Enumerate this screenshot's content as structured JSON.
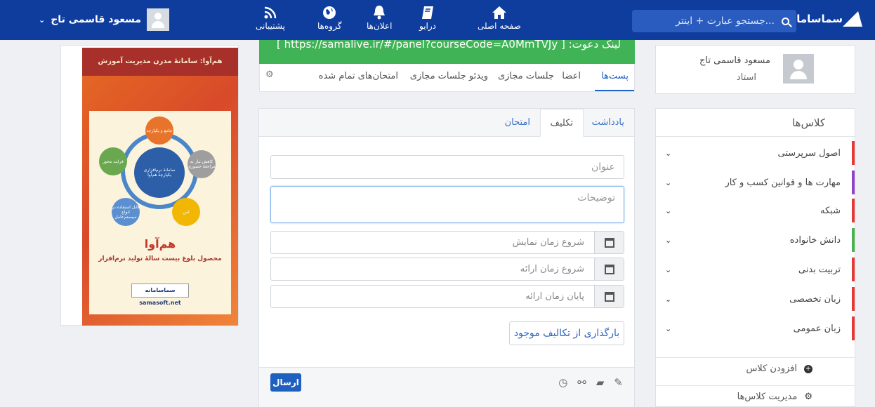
{
  "topbar": {
    "brand": "سماسامانه",
    "search_placeholder": "جستجو عبارت + اینتر...",
    "nav": {
      "home": "صفحه اصلی",
      "drive": "درایو",
      "notifications": "اعلان‌ها",
      "groups": "گروه‌ها",
      "support": "پشتیبانی"
    },
    "user_name": "مسعود قاسمی تاج"
  },
  "profile": {
    "name": "مسعود قاسمی تاج",
    "role": "استاد"
  },
  "classes": {
    "title": "کلاس‌ها",
    "items": [
      {
        "label": "اصول سرپرستی",
        "color": "#e53935"
      },
      {
        "label": "مهارت ها و قوانین کسب و کار",
        "color": "#8e44c9"
      },
      {
        "label": "شبکه",
        "color": "#e53935"
      },
      {
        "label": "دانش خانواده",
        "color": "#4caf50"
      },
      {
        "label": "تربیت بدنی",
        "color": "#e53935"
      },
      {
        "label": "زبان تخصصی",
        "color": "#e53935"
      },
      {
        "label": "زبان عمومی",
        "color": "#e53935"
      }
    ],
    "add_class": "افزودن کلاس",
    "manage_classes": "مدیریت کلاس‌ها"
  },
  "invite": {
    "text": "[ https://samalive.ir/#/panel?courseCode=A0MmTVJy ] :لینک دعوت"
  },
  "course_tabs": {
    "posts": "پست‌ها",
    "members": "اعضا",
    "virtual_sessions": "جلسات مجازی",
    "session_videos": "ویدئو جلسات مجازی",
    "finished_exams": "امتحان‌های تمام شده"
  },
  "post_form": {
    "tabs": {
      "note": "یادداشت",
      "assignment": "تکلیف",
      "exam": "امتحان"
    },
    "title_placeholder": "عنوان",
    "description_placeholder": "توضیحات",
    "show_start": "شروع زمان نمایش",
    "submit_start": "شروع زمان ارائه",
    "submit_end": "پایان زمان ارائه",
    "upload_existing": "بارگذاری از تکالیف موجود",
    "send": "ارسال"
  },
  "banner": {
    "header": "هم‌آوا: سامانهٔ مدرن مدیریت آموزش",
    "center": "سامانهٔ نرم‌افزاری یکپارچهٔ هم‌آوا",
    "node_top": "جامع و یکپارچه",
    "node_right": "کاهش نیاز به مراجعهٔ حضوری",
    "node_bottom_right": "امن",
    "node_bottom_left": "قابل استفاده در انواع سیستم‌عامل",
    "node_left": "فرایند محور",
    "title": "هم‌آوا",
    "subtitle": "محصول بلوغ بیست سالهٔ تولید نرم‌افزار",
    "logo": "سماسامانه samasoft.net"
  }
}
